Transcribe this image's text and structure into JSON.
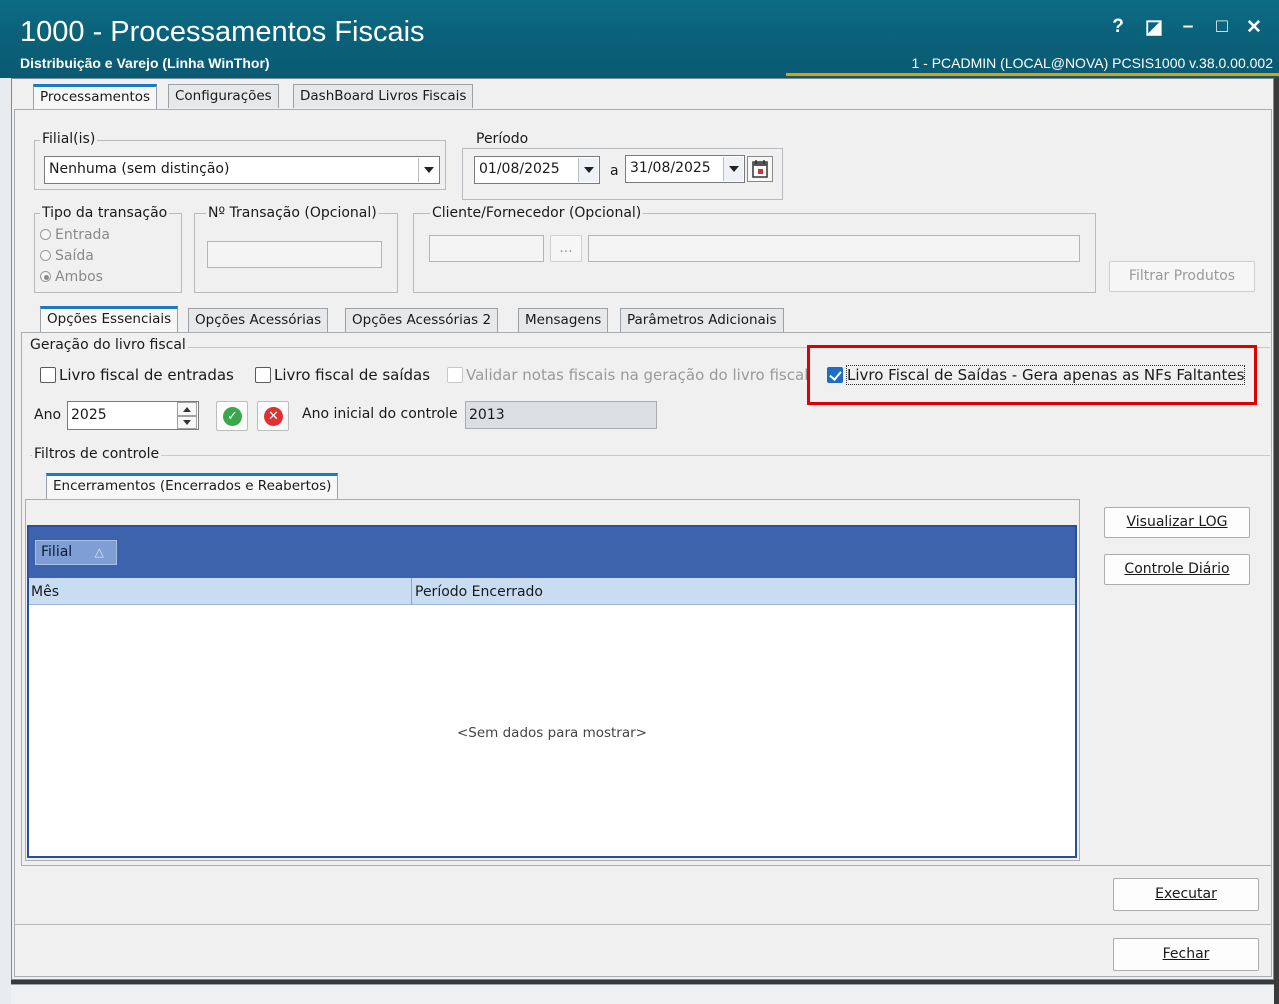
{
  "window": {
    "title": "1000 - Processamentos Fiscais",
    "subtitle": "Distribuição e Varejo (Linha WinThor)",
    "session": "1 - PCADMIN (LOCAL@NOVA)   PCSIS1000  v.38.0.00.002",
    "controls": {
      "help": "?",
      "restore": "◪",
      "minimize": "–",
      "maximize": "□",
      "close": "✕"
    }
  },
  "main_tabs": [
    "Processamentos",
    "Configurações",
    "DashBoard Livros Fiscais"
  ],
  "filial": {
    "label": "Filial(is)",
    "value": "Nenhuma (sem distinção)"
  },
  "periodo": {
    "label": "Período",
    "start": "01/08/2025",
    "separator": "a",
    "end": "31/08/2025"
  },
  "tipo_transacao": {
    "label": "Tipo da transação",
    "options": [
      "Entrada",
      "Saída",
      "Ambos"
    ],
    "selected": "Ambos"
  },
  "num_transacao": {
    "label": "Nº Transação (Opcional)",
    "value": ""
  },
  "cliente_fornecedor": {
    "label": "Cliente/Fornecedor (Opcional)",
    "browse": "...",
    "code": "",
    "name": ""
  },
  "filtrar_produtos": "Filtrar Produtos",
  "option_tabs": [
    "Opções Essenciais",
    "Opções Acessórias",
    "Opções Acessórias 2",
    "Mensagens",
    "Parâmetros Adicionais"
  ],
  "geracao": {
    "label": "Geração do livro fiscal",
    "chk_entradas": "Livro fiscal de entradas",
    "chk_saidas": "Livro fiscal de saídas",
    "chk_validar": "Validar notas fiscais na geração do livro fiscal",
    "chk_faltantes": "Livro Fiscal de Saídas - Gera apenas as NFs Faltantes",
    "ano_label": "Ano",
    "ano_value": "2025",
    "ano_inicial_label": "Ano inicial do controle",
    "ano_inicial_value": "2013"
  },
  "filtros": {
    "label": "Filtros de controle",
    "tab": "Encerramentos (Encerrados e Reabertos)",
    "group_column": "Filial",
    "group_sort": "△",
    "columns": [
      "Mês",
      "Período Encerrado"
    ],
    "empty": "<Sem dados para mostrar>"
  },
  "buttons": {
    "visualizar_log": "Visualizar LOG",
    "controle_diario": "Controle Diário",
    "executar": "Executar",
    "fechar": "Fechar"
  }
}
